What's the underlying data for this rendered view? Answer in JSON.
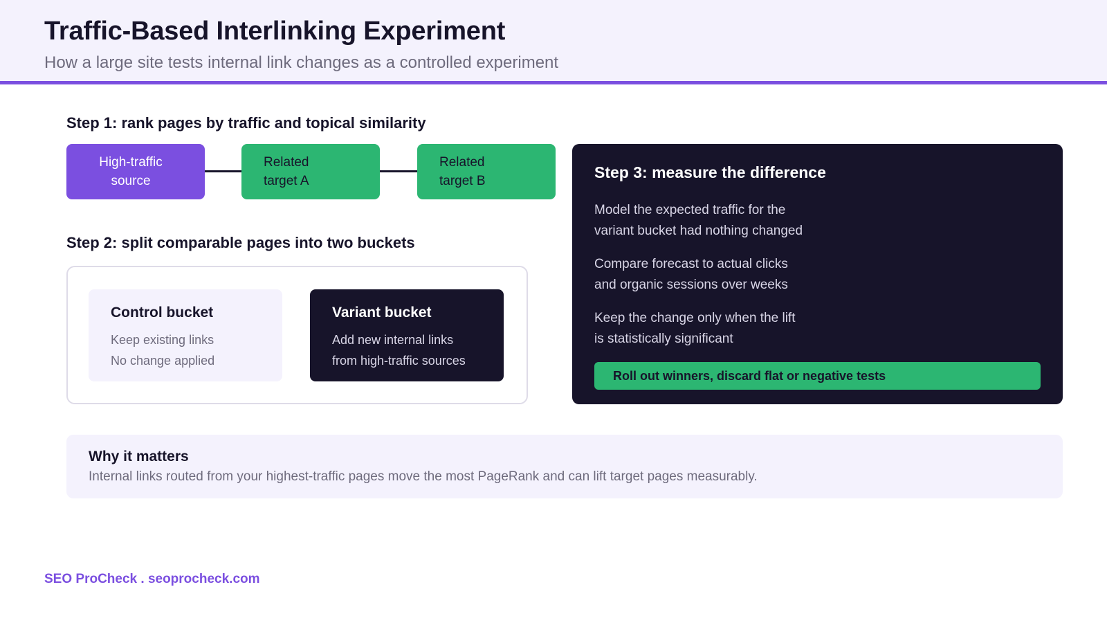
{
  "header": {
    "title": "Traffic-Based Interlinking Experiment",
    "subtitle": "How a large site tests internal link changes as a controlled experiment"
  },
  "step1": {
    "title": "Step 1: rank pages by traffic and topical similarity",
    "nodes": [
      {
        "line1": "High-traffic",
        "line2": "source",
        "color": "#7b4fe0"
      },
      {
        "line1": "Related",
        "line2": "target A",
        "color": "#2cb672"
      },
      {
        "line1": "Related",
        "line2": "target B",
        "color": "#2cb672"
      }
    ]
  },
  "step2": {
    "title": "Step 2: split comparable pages into two buckets",
    "control": {
      "title": "Control bucket",
      "line1": "Keep existing links",
      "line2": "No change applied"
    },
    "variant": {
      "title": "Variant bucket",
      "line1": "Add new internal links",
      "line2": "from high-traffic sources"
    }
  },
  "step3": {
    "title": "Step 3: measure the difference",
    "points": [
      {
        "line1": "Model the expected traffic for the",
        "line2": "variant bucket had nothing changed"
      },
      {
        "line1": "Compare forecast to actual clicks",
        "line2": "and organic sessions over weeks"
      },
      {
        "line1": "Keep the change only when the lift",
        "line2": "is statistically significant"
      }
    ],
    "cta": "Roll out winners, discard flat or negative tests"
  },
  "why": {
    "title": "Why it matters",
    "text": "Internal links routed from your highest-traffic pages move the most PageRank and can lift target pages measurably."
  },
  "footer": {
    "text": "SEO ProCheck . seoprocheck.com"
  },
  "colors": {
    "accent": "#7b4fe0",
    "success": "#2cb672",
    "dark": "#17142a",
    "light_bg": "#f4f2fd"
  }
}
